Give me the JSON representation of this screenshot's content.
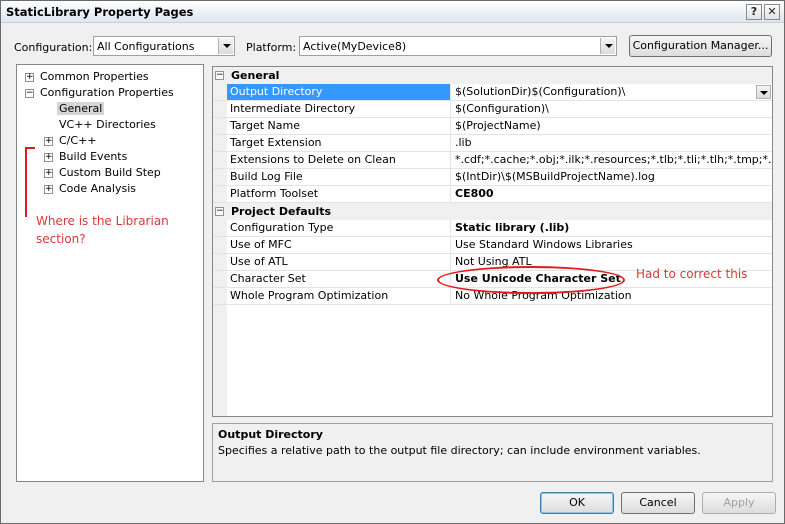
{
  "window": {
    "title": "StaticLibrary Property Pages"
  },
  "toolbar": {
    "configuration_label": "Configuration:",
    "configuration_value": "All Configurations",
    "platform_label": "Platform:",
    "platform_value": "Active(MyDevice8)",
    "config_manager_label": "Configuration Manager..."
  },
  "tree": {
    "common_properties": "Common Properties",
    "configuration_properties": "Configuration Properties",
    "general": "General",
    "vc_directories": "VC++ Directories",
    "c_cpp": "C/C++",
    "build_events": "Build Events",
    "custom_build_step": "Custom Build Step",
    "code_analysis": "Code Analysis"
  },
  "grid": {
    "general_category": "General",
    "project_defaults_category": "Project Defaults",
    "general_rows": [
      {
        "name": "Output Directory",
        "value": "$(SolutionDir)$(Configuration)\\"
      },
      {
        "name": "Intermediate Directory",
        "value": "$(Configuration)\\"
      },
      {
        "name": "Target Name",
        "value": "$(ProjectName)"
      },
      {
        "name": "Target Extension",
        "value": ".lib"
      },
      {
        "name": "Extensions to Delete on Clean",
        "value": "*.cdf;*.cache;*.obj;*.ilk;*.resources;*.tlb;*.tli;*.tlh;*.tmp;*.rsp;"
      },
      {
        "name": "Build Log File",
        "value": "$(IntDir)\\$(MSBuildProjectName).log"
      },
      {
        "name": "Platform Toolset",
        "value": "CE800"
      }
    ],
    "defaults_rows": [
      {
        "name": "Configuration Type",
        "value": "Static library (.lib)"
      },
      {
        "name": "Use of MFC",
        "value": "Use Standard Windows Libraries"
      },
      {
        "name": "Use of ATL",
        "value": "Not Using ATL"
      },
      {
        "name": "Character Set",
        "value": "Use Unicode Character Set"
      },
      {
        "name": "Whole Program Optimization",
        "value": "No Whole Program Optimization"
      }
    ]
  },
  "description": {
    "title": "Output Directory",
    "text": "Specifies a relative path to the output file directory; can include environment variables."
  },
  "buttons": {
    "ok": "OK",
    "cancel": "Cancel",
    "apply": "Apply"
  },
  "annotations": {
    "librarian_question_line1": "Where is the Librarian",
    "librarian_question_line2": "section?",
    "correction_note": "Had to correct this"
  },
  "colors": {
    "annotation_red": "#e21b1b",
    "selection_blue": "#3399ff"
  }
}
